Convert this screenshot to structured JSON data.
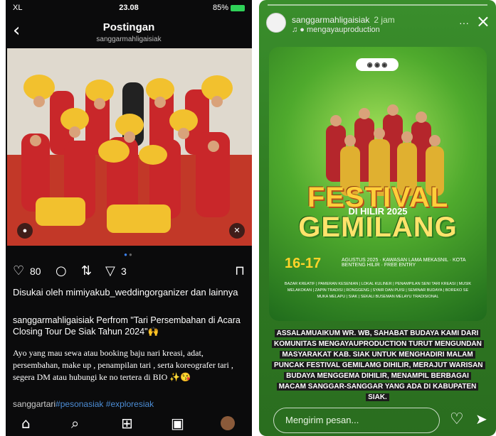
{
  "post": {
    "status": {
      "carrier": "XL",
      "time": "23.08",
      "battery": "85%"
    },
    "header": {
      "title": "Postingan",
      "account": "sanggarmahligaisiak"
    },
    "actions": {
      "likes_count": "80",
      "shares_count": "3"
    },
    "liked_by": "Disukai oleh mimiyakub_weddingorganizer dan lainnya",
    "caption": "sanggarmahligaisiak Perfrom \"Tari Persembahan di Acara Closing Tour De Siak Tahun 2024\"🙌",
    "description": "Ayo yang mau sewa atau booking baju nari kreasi, adat, persembahan, make up , penampilan tari , serta koreografer tari , segera DM atau hubungi ke no tertera di BIO ✨😘",
    "tags": {
      "prefix": "sanggartari",
      "tag1": "#pesonasiak",
      "tag2": "#exploresiak"
    },
    "nav": [
      "home-icon",
      "search-icon",
      "create-icon",
      "reels-icon",
      "profile-avatar"
    ],
    "colors": {
      "background": "#0b0b0c",
      "link": "#4c8dd6",
      "battery": "#2fd158"
    }
  },
  "story": {
    "account": "sanggarmahligaisiak",
    "time": "2 jam",
    "music": "mengayauproduction",
    "poster": {
      "title1": "FESTIVAL",
      "subtitle": "DI HILIR 2025",
      "title2": "GEMILANG",
      "date": "16-17",
      "date_detail": "AGUSTUS 2025 · KAWASAN LAMA MEKASNIL · KOTA BENTENG HILIR · FREE ENTRY",
      "info": "BAZAR KREATIF | PAMERAN KESENIAN | LOKAL KULINER | PENAMPILAN SENI TARI KREASI | MUSIK MELAKOKAN | ZAPIN TRADISI | RONGGENG | SYAIR DAN PUISI | SEMINAR BUDAYA | BOREKO SE MUKA MELAPU | SIAK | SEKALI BUSEMAN MELAYU TRADISIONAL"
    },
    "message": "ASSALAMUAIKUM WR. WB, SAHABAT BUDAYA KAMI DARI KOMUNITAS MENGAYAUPRODUCTION TURUT MENGUNDAN MASYARAKAT KAB. SIAK UNTUK MENGHADIRI MALAM PUNCAK FESTIVAL GEMILAMG DIHILIR, MERAJUT WARISAN BUDAYA MENGGEMA DIHILIR, MENAMPIL BERBAGAI MACAM SANGGAR-SANGGAR YANG ADA DI KABUPATEN SIAK.",
    "reply_placeholder": "Mengirim pesan...",
    "colors": {
      "story_green": "#3a8e2c",
      "title_gold": "#ffcf3a",
      "message_bg": "#1c1c1c"
    }
  }
}
